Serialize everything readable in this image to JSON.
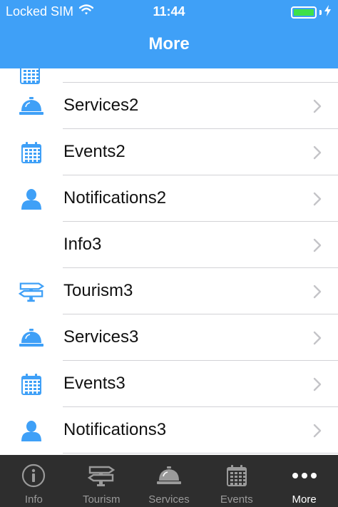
{
  "status_bar": {
    "carrier": "Locked SIM",
    "time": "11:44",
    "battery_level": 1.0
  },
  "nav": {
    "title": "More"
  },
  "colors": {
    "accent": "#3fa0f7",
    "tabbar_bg": "#2e2e2e",
    "tab_inactive": "#9a9a9a",
    "tab_active": "#ffffff",
    "battery_fill": "#3ee04a"
  },
  "list": {
    "partial_item_icon": "calendar-icon",
    "items": [
      {
        "label": "Services2",
        "icon": "bell-icon"
      },
      {
        "label": "Events2",
        "icon": "calendar-icon"
      },
      {
        "label": "Notifications2",
        "icon": "person-icon"
      },
      {
        "label": "Info3",
        "icon": ""
      },
      {
        "label": "Tourism3",
        "icon": "signpost-icon"
      },
      {
        "label": "Services3",
        "icon": "bell-icon"
      },
      {
        "label": "Events3",
        "icon": "calendar-icon"
      },
      {
        "label": "Notifications3",
        "icon": "person-icon"
      }
    ]
  },
  "tabbar": {
    "tabs": [
      {
        "label": "Info",
        "icon": "info-icon",
        "active": false
      },
      {
        "label": "Tourism",
        "icon": "signpost-icon",
        "active": false
      },
      {
        "label": "Services",
        "icon": "bell-icon",
        "active": false
      },
      {
        "label": "Events",
        "icon": "calendar-icon",
        "active": false
      },
      {
        "label": "More",
        "icon": "more-icon",
        "active": true
      }
    ]
  }
}
